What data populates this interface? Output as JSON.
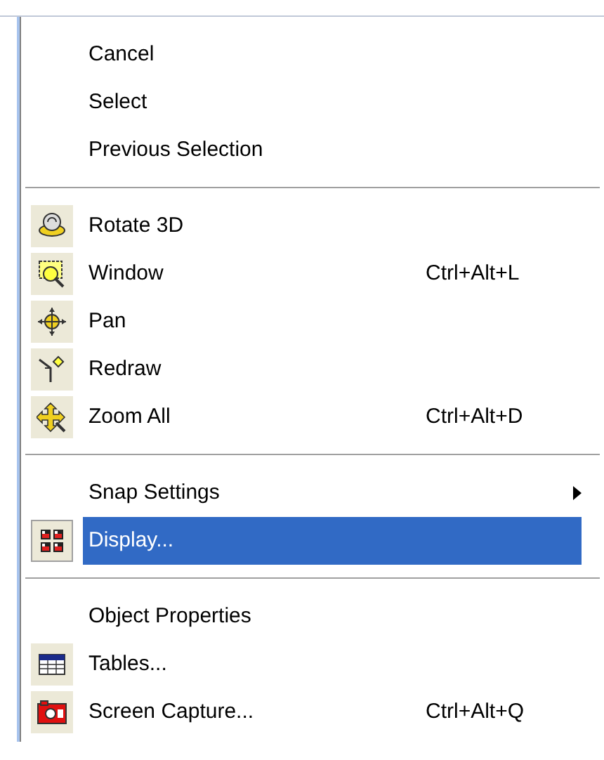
{
  "menu": {
    "items": [
      {
        "kind": "item",
        "label": "Cancel",
        "selected": false
      },
      {
        "kind": "item",
        "label": "Select",
        "selected": false
      },
      {
        "kind": "item",
        "label": "Previous Selection",
        "selected": false
      },
      {
        "kind": "separator"
      },
      {
        "kind": "icon_item",
        "label": "Rotate 3D",
        "selected": false
      },
      {
        "kind": "icon_item",
        "label": "Window",
        "shortcut": "Ctrl+Alt+L",
        "selected": false
      },
      {
        "kind": "icon_item",
        "label": "Pan",
        "selected": false
      },
      {
        "kind": "icon_item",
        "label": "Redraw",
        "selected": false
      },
      {
        "kind": "icon_item",
        "label": "Zoom All",
        "shortcut": "Ctrl+Alt+D",
        "selected": false
      },
      {
        "kind": "separator"
      },
      {
        "kind": "submenu",
        "label": "Snap Settings",
        "selected": false
      },
      {
        "kind": "icon_item",
        "label": "Display...",
        "selected": true
      },
      {
        "kind": "separator"
      },
      {
        "kind": "item",
        "label": "Object Properties",
        "selected": false
      },
      {
        "kind": "icon_item",
        "label": "Tables...",
        "selected": false
      },
      {
        "kind": "icon_item",
        "label": "Screen Capture...",
        "shortcut": "Ctrl+Alt+Q",
        "selected": false
      }
    ]
  }
}
